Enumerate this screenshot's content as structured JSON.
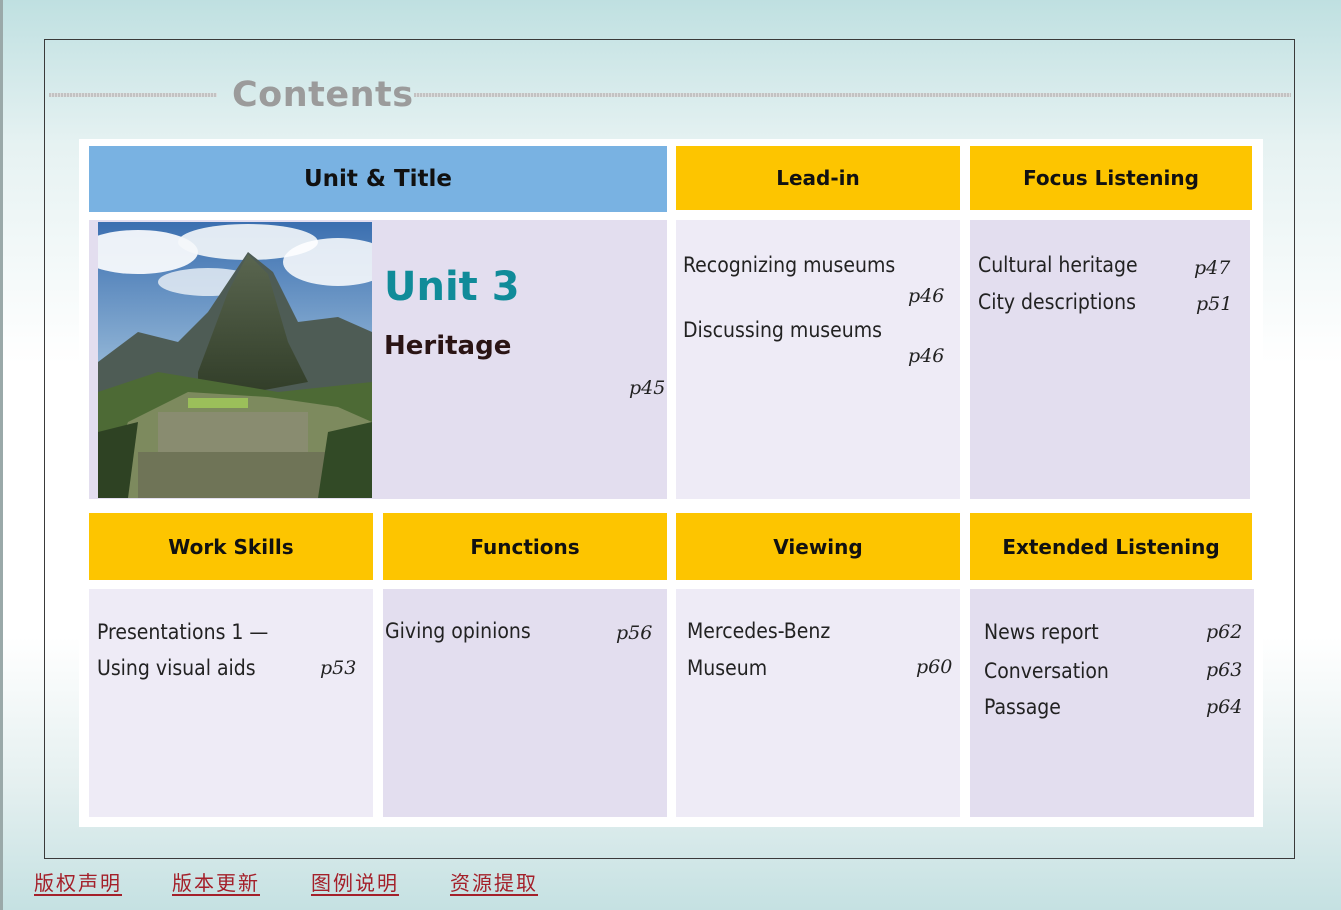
{
  "page": {
    "title": "Contents"
  },
  "header": {
    "unit_title": "Unit & Title",
    "lead_in": "Lead-in",
    "focus_listening": "Focus Listening",
    "work_skills": "Work Skills",
    "functions": "Functions",
    "viewing": "Viewing",
    "extended_listening": "Extended Listening"
  },
  "unit": {
    "number": "Unit 3",
    "name": "Heritage",
    "page": "p45",
    "image": "mountain-ruins-photo"
  },
  "lead_in": {
    "items": [
      {
        "label": "Recognizing museums",
        "page": "p46"
      },
      {
        "label": "Discussing museums",
        "page": "p46"
      }
    ]
  },
  "focus_listening": {
    "items": [
      {
        "label": "Cultural heritage",
        "page": "p47"
      },
      {
        "label": "City descriptions",
        "page": "p51"
      }
    ]
  },
  "work_skills": {
    "line1": "Presentations 1 —",
    "line2": "Using visual aids",
    "page": "p53"
  },
  "functions": {
    "label": "Giving opinions",
    "page": "p56"
  },
  "viewing": {
    "line1": "Mercedes-Benz",
    "line2": "Museum",
    "page": "p60"
  },
  "extended_listening": {
    "items": [
      {
        "label": "News report",
        "page": "p62"
      },
      {
        "label": "Conversation",
        "page": "p63"
      },
      {
        "label": "Passage",
        "page": "p64"
      }
    ]
  },
  "footer": {
    "links": [
      "版权声明",
      "版本更新",
      "图例说明",
      "资源提取"
    ]
  },
  "colors": {
    "header_blue": "#79b2e2",
    "header_yellow": "#fdc500",
    "cell_lavender": "#e3deef",
    "unit_teal": "#108b99",
    "footer_red": "#a4202a"
  }
}
